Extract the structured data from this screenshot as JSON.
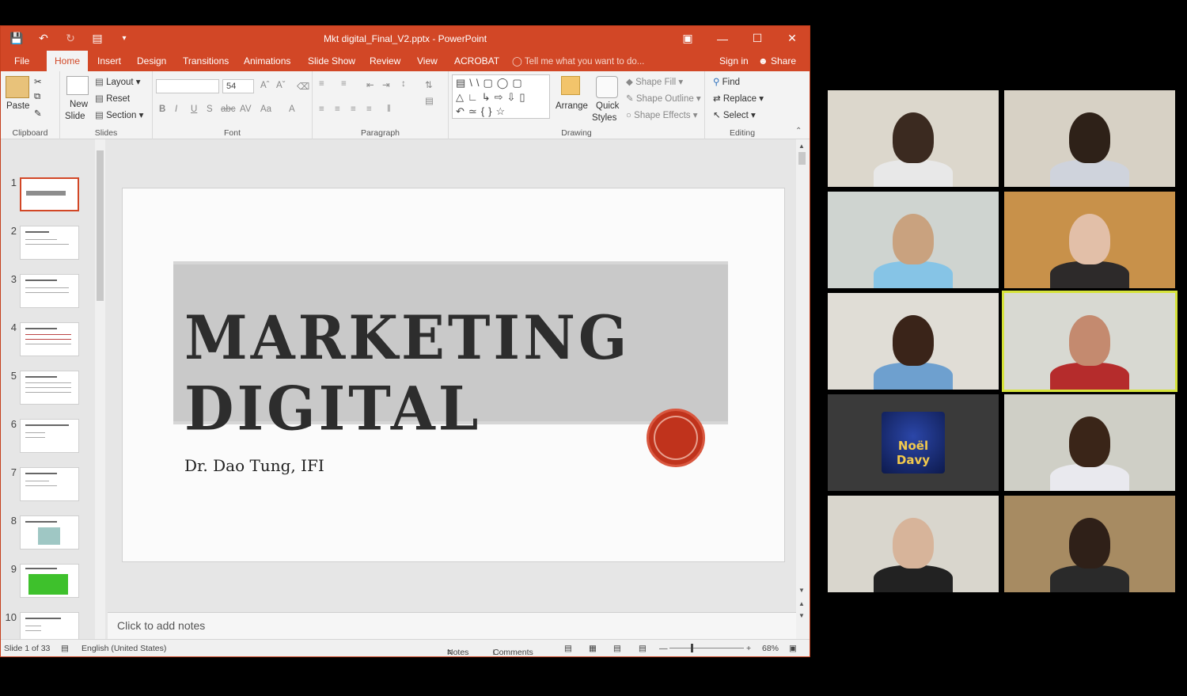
{
  "window": {
    "doc_title": "Mkt digital_Final_V2.pptx - PowerPoint"
  },
  "tabs": [
    "File",
    "Home",
    "Insert",
    "Design",
    "Transitions",
    "Animations",
    "Slide Show",
    "Review",
    "View",
    "ACROBAT"
  ],
  "active_tab": "Home",
  "tell_me": "Tell me what you want to do...",
  "account": {
    "sign_in": "Sign in",
    "share": "Share"
  },
  "ribbon": {
    "clipboard": {
      "paste": "Paste",
      "label": "Clipboard"
    },
    "slides": {
      "new_slide_1": "New",
      "new_slide_2": "Slide",
      "layout": "Layout",
      "reset": "Reset",
      "section": "Section",
      "label": "Slides"
    },
    "font": {
      "name_value": "",
      "size_value": "54",
      "label": "Font"
    },
    "paragraph": {
      "label": "Paragraph"
    },
    "drawing": {
      "arrange": "Arrange",
      "quick_styles_1": "Quick",
      "quick_styles_2": "Styles",
      "shape_fill": "Shape Fill",
      "shape_outline": "Shape Outline",
      "shape_effects": "Shape Effects",
      "label": "Drawing"
    },
    "editing": {
      "find": "Find",
      "replace": "Replace",
      "select": "Select",
      "label": "Editing"
    }
  },
  "thumbnails": [
    {
      "num": "1",
      "selected": true
    },
    {
      "num": "2"
    },
    {
      "num": "3"
    },
    {
      "num": "4"
    },
    {
      "num": "5"
    },
    {
      "num": "6"
    },
    {
      "num": "7"
    },
    {
      "num": "8"
    },
    {
      "num": "9"
    },
    {
      "num": "10"
    }
  ],
  "slide": {
    "title": "MARKETING DIGITAL",
    "author": "Dr. Dao Tung, IFI"
  },
  "notes_placeholder": "Click to add notes",
  "status": {
    "slide_of": "Slide 1 of 33",
    "language": "English (United States)",
    "notes": "Notes",
    "comments": "Comments",
    "zoom": "68%"
  },
  "video_tiles": [
    {
      "bg": "#dcd7cc",
      "skin": "#3b2a20",
      "shirt": "#e8e8e8"
    },
    {
      "bg": "#d7d1c5",
      "skin": "#2e2118",
      "shirt": "#cfd3dc"
    },
    {
      "bg": "#cfd4d0",
      "skin": "#c9a27f",
      "shirt": "#86c4e6"
    },
    {
      "bg": "#c8914a",
      "skin": "#e2bfa8",
      "shirt": "#2d2a2a"
    },
    {
      "bg": "#e0ddd6",
      "skin": "#3a2419",
      "shirt": "#6ea0cf"
    },
    {
      "bg": "#d8d9d2",
      "skin": "#c48a6f",
      "shirt": "#b52c2c"
    },
    {
      "bg": "#3a3a3a",
      "label": "Noël Davy"
    },
    {
      "bg": "#cfcfc6",
      "skin": "#3a2518",
      "shirt": "#e9e9ee"
    },
    {
      "bg": "#d9d6cd",
      "skin": "#d7b49a",
      "shirt": "#222222"
    },
    {
      "bg": "#a78b62",
      "skin": "#2f2018",
      "shirt": "#2a2a2a"
    }
  ],
  "colors": {
    "accent": "#d24726",
    "active_speaker": "#d6e33a"
  }
}
